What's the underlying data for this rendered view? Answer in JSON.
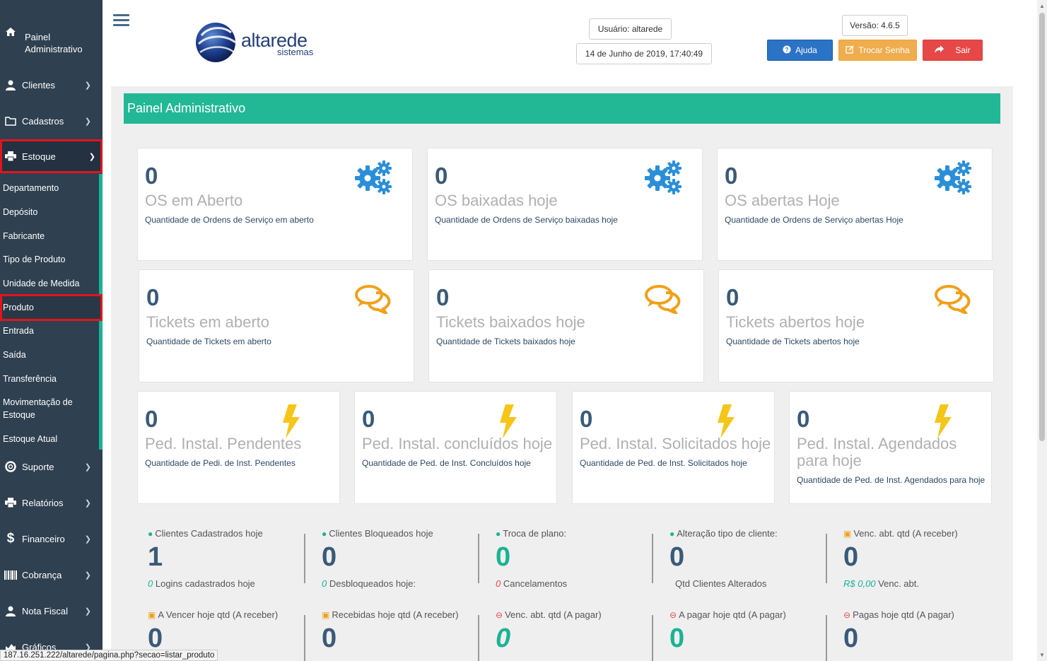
{
  "sidebar": {
    "items": [
      {
        "label": "Painel Administrativo",
        "icon": "home-icon"
      },
      {
        "label": "Clientes",
        "icon": "user-icon"
      },
      {
        "label": "Cadastros",
        "icon": "folder-icon"
      },
      {
        "label": "Estoque",
        "icon": "printer-icon"
      },
      {
        "label": "Suporte",
        "icon": "lifebuoy-icon"
      },
      {
        "label": "Relatórios",
        "icon": "printer-icon"
      },
      {
        "label": "Financeiro",
        "icon": "dollar-icon"
      },
      {
        "label": "Cobrança",
        "icon": "barcode-icon"
      },
      {
        "label": "Nota Fiscal",
        "icon": "user-icon"
      },
      {
        "label": "Gráficos",
        "icon": "chart-icon"
      }
    ],
    "stock_submenu": [
      "Departamento",
      "Depósito",
      "Fabricante",
      "Tipo de Produto",
      "Unidade de Medida",
      "Produto",
      "Entrada",
      "Saída",
      "Transferência",
      "Movimentação de Estoque",
      "Estoque Atual"
    ],
    "selected_submenu": "Produto"
  },
  "header": {
    "logo_text": "altarede",
    "logo_subtext": "sistemas",
    "user": "Usuário: altarede",
    "datetime": "14 de Junho de 2019, 17:40:49",
    "version": "Versão: 4.6.5",
    "help_label": "Ajuda",
    "change_password_label": "Trocar Senha",
    "exit_label": "Sair"
  },
  "panel_title": "Painel Administrativo",
  "os_cards": [
    {
      "count": "0",
      "title": "OS em Aberto",
      "desc": "Quantidade de Ordens de Serviço em aberto"
    },
    {
      "count": "0",
      "title": "OS baixadas hoje",
      "desc": "Quantidade de Ordens de Serviço baixadas hoje"
    },
    {
      "count": "0",
      "title": "OS abertas Hoje",
      "desc": "Quantidade de Ordens de Serviço abertas Hoje"
    }
  ],
  "ticket_cards": [
    {
      "count": "0",
      "title": "Tickets em aberto",
      "desc": "Quantidade de Tickets em aberto"
    },
    {
      "count": "0",
      "title": "Tickets baixados hoje",
      "desc": "Quantidade de Tickets baixados hoje"
    },
    {
      "count": "0",
      "title": "Tickets abertos hoje",
      "desc": "Quantidade de Tickets abertos hoje"
    }
  ],
  "install_cards": [
    {
      "count": "0",
      "title": "Ped. Instal. Pendentes",
      "desc": "Quantidade de Pedi. de Inst. Pendentes"
    },
    {
      "count": "0",
      "title": "Ped. Instal. concluídos hoje",
      "desc": "Quantidade de Ped. de Inst. Concluídos hoje"
    },
    {
      "count": "0",
      "title": "Ped. Instal. Solicitados hoje",
      "desc": "Quantidade de Ped. de Inst. Solicitados hoje"
    },
    {
      "count": "0",
      "title": "Ped. Instal. Agendados para hoje",
      "desc": "Quantidade de Ped. de Inst. Agendados para hoje"
    }
  ],
  "stats_row1": [
    {
      "head": "Clientes Cadastrados hoje",
      "value": "1",
      "foot_pre": "0",
      "foot": "Logins cadastrados hoje"
    },
    {
      "head": "Clientes Bloqueados hoje",
      "value": "0",
      "foot_pre": "0",
      "foot": "Desbloqueados hoje:"
    },
    {
      "head": "Troca de plano:",
      "value": "0",
      "foot_pre": "0",
      "foot": "Cancelamentos"
    },
    {
      "head": "Alteração tipo de cliente:",
      "value": "0",
      "foot_pre": "",
      "foot": "Qtd Clientes Alterados"
    },
    {
      "head": "Venc. abt. qtd (A receber)",
      "value": "0",
      "foot_pre": "R$ 0,00",
      "foot": "Venc. abt."
    }
  ],
  "stats_row2": [
    {
      "head": "A Vencer hoje qtd (A receber)",
      "value": "0"
    },
    {
      "head": "Recebidas hoje qtd (A receber)",
      "value": "0"
    },
    {
      "head": "Venc. abt. qtd (A pagar)",
      "value": "0"
    },
    {
      "head": "A pagar hoje qtd (A pagar)",
      "value": "0"
    },
    {
      "head": "Pagas hoje qtd (A pagar)",
      "value": "0"
    }
  ],
  "colors": {
    "sidebar": "#2f4050",
    "accent": "#22b896",
    "card_number": "#3a5a78",
    "gear": "#2a8fd8",
    "chat": "#f0a01a",
    "bolt": "#f5c518",
    "highlight": "#e2151d"
  },
  "status_bar_url": "187.16.251.222/altarede/pagina.php?secao=listar_produto"
}
